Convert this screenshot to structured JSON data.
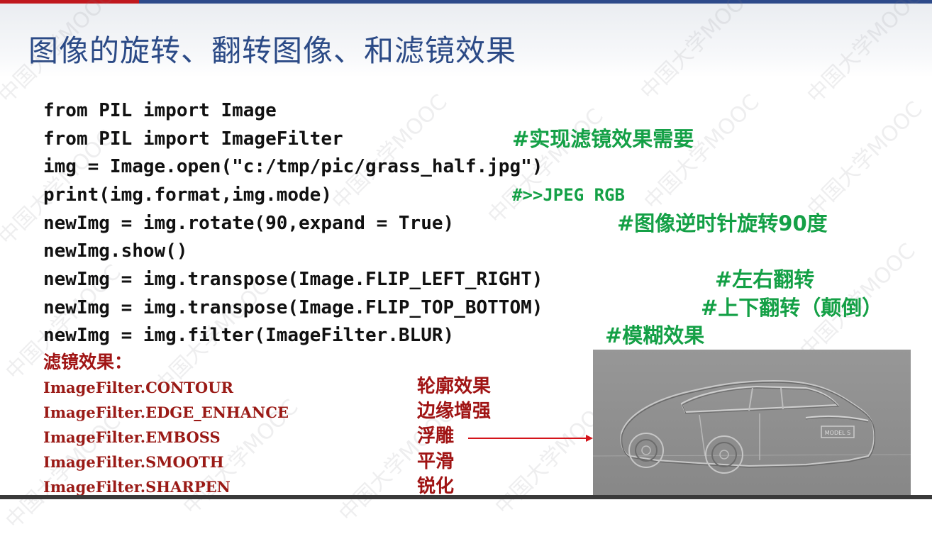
{
  "title": "图像的旋转、翻转图像、和滤镜效果",
  "watermark_text": "中国大学MOOC",
  "code_lines": [
    "from PIL import Image",
    "from PIL import ImageFilter",
    "img = Image.open(\"c:/tmp/pic/grass_half.jpg\")",
    "print(img.format,img.mode)",
    "newImg = img.rotate(90,expand = True)",
    "newImg.show()",
    "newImg = img.transpose(Image.FLIP_LEFT_RIGHT)",
    "newImg = img.transpose(Image.FLIP_TOP_BOTTOM)",
    "newImg = img.filter(ImageFilter.BLUR)"
  ],
  "comments": {
    "import_filter": "#实现滤镜效果需要",
    "print_output": "#>>JPEG RGB",
    "rotate": "#图像逆时针旋转90度",
    "flip_lr": "#左右翻转",
    "flip_tb": "#上下翻转（颠倒）",
    "blur": "#模糊效果"
  },
  "filters_label": "滤镜效果：",
  "filters": [
    {
      "name": "ImageFilter.CONTOUR",
      "desc": "轮廓效果"
    },
    {
      "name": "ImageFilter.EDGE_ENHANCE",
      "desc": "边缘增强"
    },
    {
      "name": "ImageFilter.EMBOSS",
      "desc": "浮雕"
    },
    {
      "name": "ImageFilter.SMOOTH",
      "desc": "平滑"
    },
    {
      "name": "ImageFilter.SHARPEN",
      "desc": "锐化"
    }
  ],
  "license_plate_text": "MODEL S",
  "colors": {
    "title": "#2b4a86",
    "code": "#111111",
    "comment": "#14a046",
    "filter_text": "#9a1a16",
    "accent_red": "#c0181e",
    "accent_blue": "#2d4a8a"
  }
}
